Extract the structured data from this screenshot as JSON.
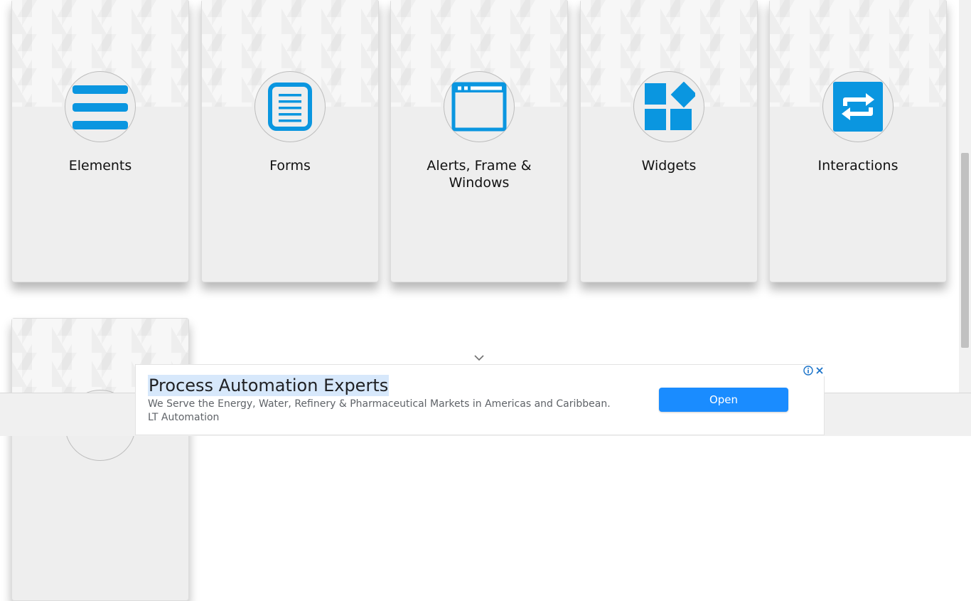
{
  "cards": [
    {
      "title": "Elements",
      "icon": "list-icon"
    },
    {
      "title": "Forms",
      "icon": "document-icon"
    },
    {
      "title": "Alerts, Frame & Windows",
      "icon": "browser-window-icon"
    },
    {
      "title": "Widgets",
      "icon": "widgets-icon"
    },
    {
      "title": "Interactions",
      "icon": "swap-arrows-icon"
    },
    {
      "title": "",
      "icon": ""
    }
  ],
  "scroll_hint": {
    "icon": "chevron-down-icon"
  },
  "ad": {
    "headline": "Process Automation Experts",
    "description": "We Serve the Energy, Water, Refinery & Pharmaceutical Markets in Americas and Caribbean. LT Automation",
    "cta": "Open",
    "info_icon": "info-icon",
    "close_icon": "close-icon"
  },
  "colors": {
    "accent": "#0a96e0",
    "card_bg": "#eeeeee",
    "cta_bg": "#1a8cff"
  }
}
